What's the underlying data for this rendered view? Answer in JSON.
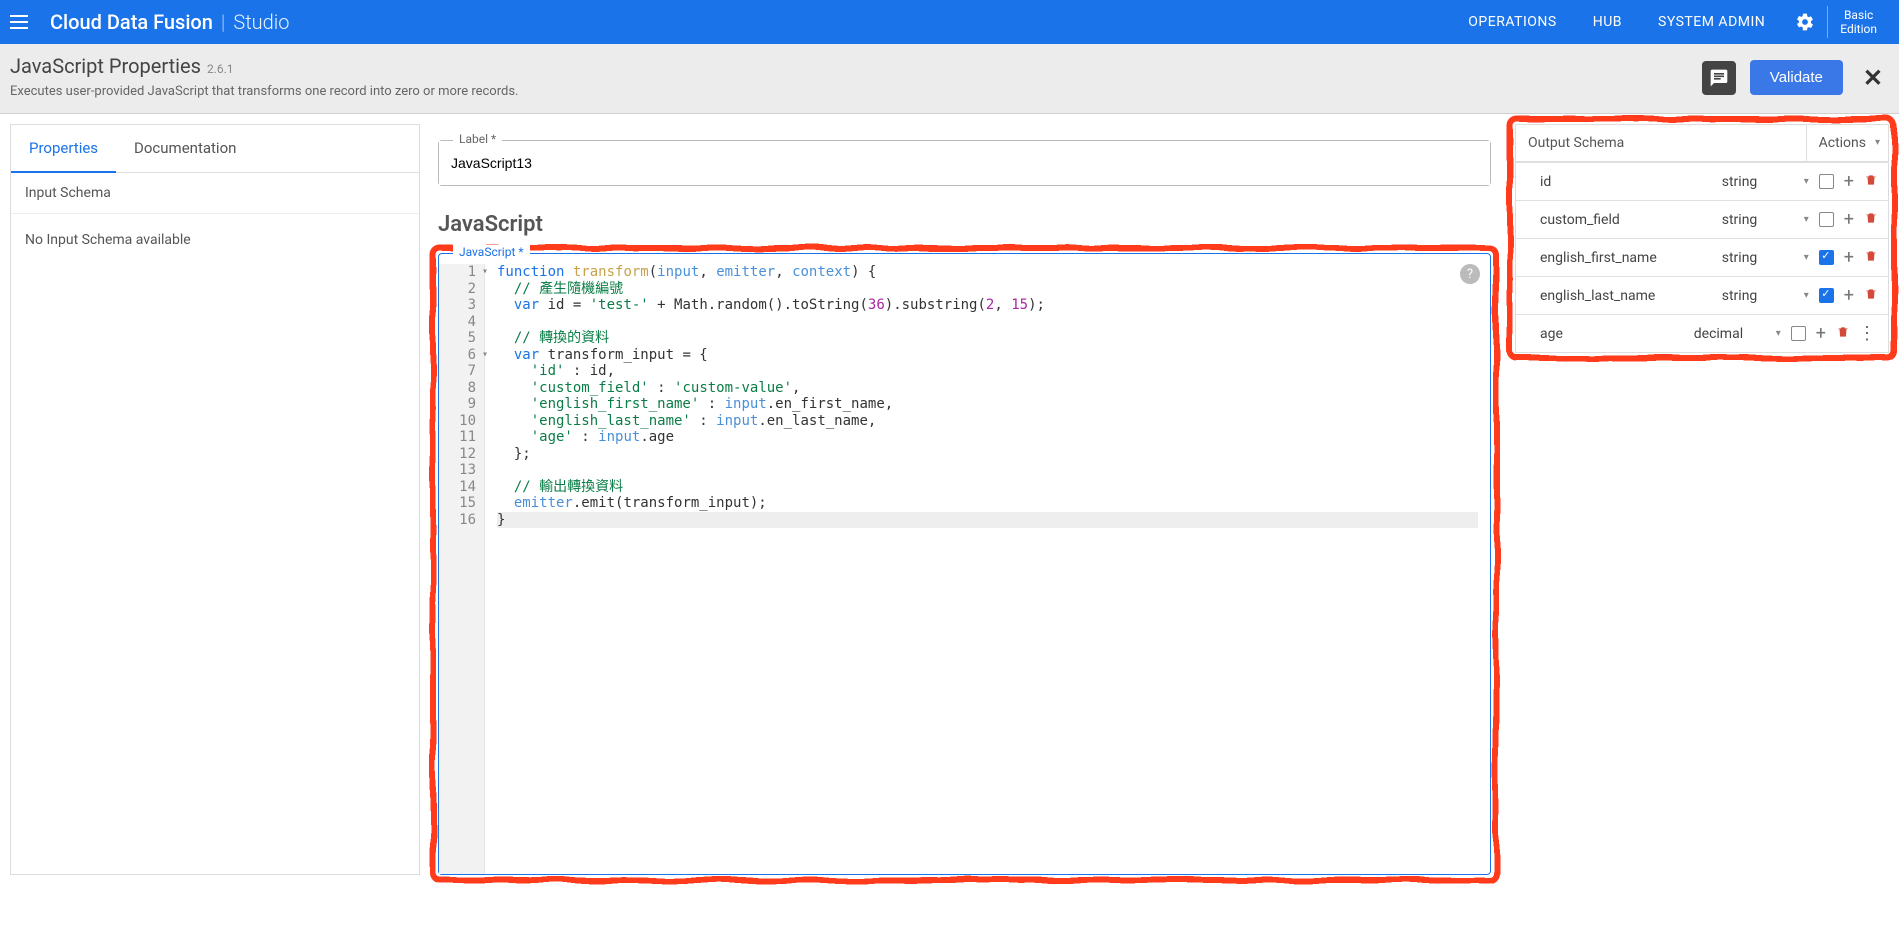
{
  "topnav": {
    "brand_main": "Cloud Data Fusion",
    "brand_sub": "Studio",
    "links": {
      "operations": "OPERATIONS",
      "hub": "HUB",
      "sysadmin": "SYSTEM ADMIN"
    },
    "edition_line1": "Basic",
    "edition_line2": "Edition"
  },
  "header": {
    "title": "JavaScript Properties",
    "version": "2.6.1",
    "subtitle": "Executes user-provided JavaScript that transforms one record into zero or more records.",
    "validate": "Validate"
  },
  "tabs": {
    "properties": "Properties",
    "documentation": "Documentation"
  },
  "left": {
    "input_schema_title": "Input Schema",
    "no_input": "No Input Schema available"
  },
  "center": {
    "label_caption": "Label *",
    "label_value": "JavaScript13",
    "section_title": "JavaScript",
    "code_caption": "JavaScript *",
    "code_lines": [
      "function transform(input, emitter, context) {",
      "  // 產生隨機編號",
      "  var id = 'test-' + Math.random().toString(36).substring(2, 15);",
      "",
      "  // 轉換的資料",
      "  var transform_input = {",
      "    'id' : id,",
      "    'custom_field' : 'custom-value',",
      "    'english_first_name' : input.en_first_name,",
      "    'english_last_name' : input.en_last_name,",
      "    'age' : input.age",
      "  };",
      "",
      "  // 輸出轉換資料",
      "  emitter.emit(transform_input);",
      "}"
    ]
  },
  "right": {
    "title": "Output Schema",
    "actions": "Actions",
    "rows": [
      {
        "name": "id",
        "type": "string",
        "checked": false
      },
      {
        "name": "custom_field",
        "type": "string",
        "checked": false
      },
      {
        "name": "english_first_name",
        "type": "string",
        "checked": true
      },
      {
        "name": "english_last_name",
        "type": "string",
        "checked": true
      },
      {
        "name": "age",
        "type": "decimal",
        "checked": false,
        "kebab": true
      }
    ]
  }
}
